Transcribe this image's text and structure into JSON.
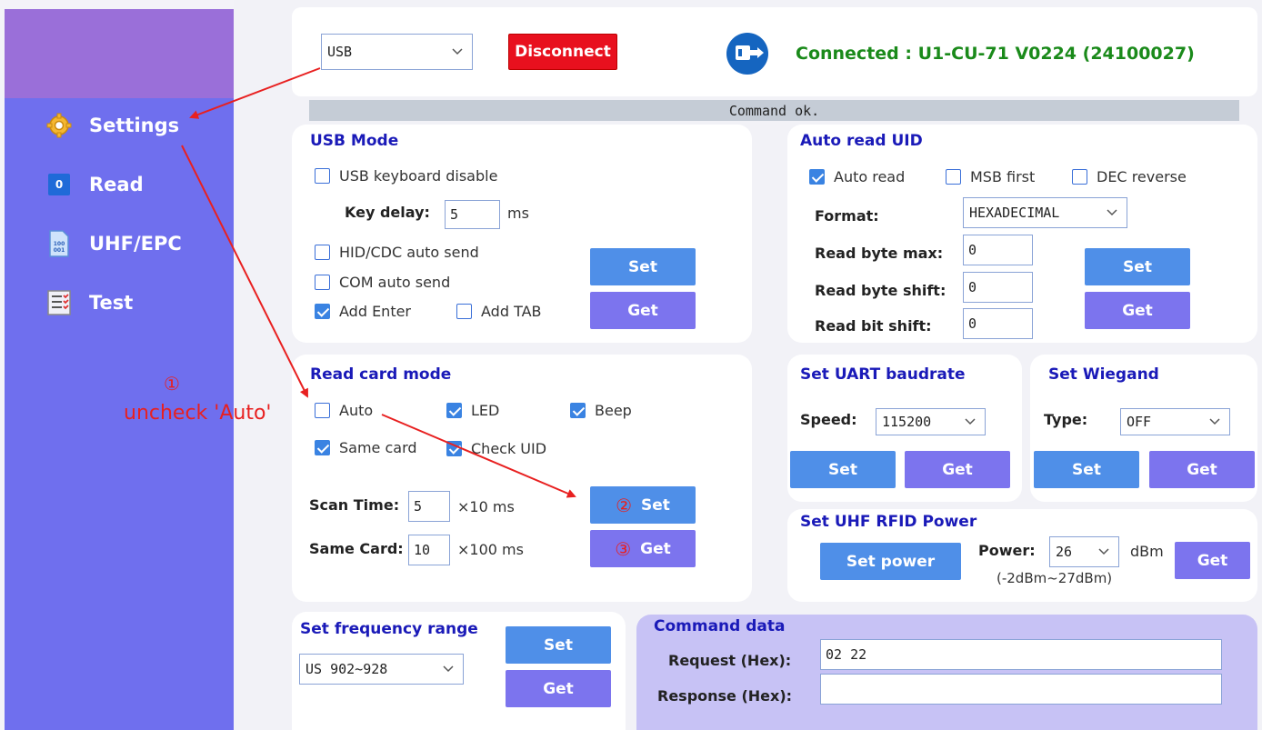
{
  "sidebar": {
    "items": [
      {
        "label": "Settings",
        "icon": "gear-icon"
      },
      {
        "label": "Read",
        "icon": "read-icon",
        "badge": "0"
      },
      {
        "label": "UHF/EPC",
        "icon": "document-icon"
      },
      {
        "label": "Test",
        "icon": "checklist-icon"
      }
    ]
  },
  "header": {
    "port_select": "USB",
    "disconnect_label": "Disconnect",
    "connection_status": "Connected : U1-CU-71 V0224 (24100027)",
    "status_bar": "Command ok."
  },
  "usb_mode": {
    "title": "USB Mode",
    "keyboard_disable": "USB keyboard disable",
    "key_delay_label": "Key delay:",
    "key_delay_value": "5",
    "key_delay_unit": "ms",
    "hid_auto_send": "HID/CDC auto send",
    "com_auto_send": "COM auto send",
    "add_enter": "Add Enter",
    "add_tab": "Add TAB",
    "set_label": "Set",
    "get_label": "Get"
  },
  "auto_read": {
    "title": "Auto read UID",
    "auto_read": "Auto read",
    "msb_first": "MSB first",
    "dec_reverse": "DEC reverse",
    "format_label": "Format:",
    "format_value": "HEXADECIMAL",
    "byte_max_label": "Read byte max:",
    "byte_max_value": "0",
    "byte_shift_label": "Read byte shift:",
    "byte_shift_value": "0",
    "bit_shift_label": "Read bit shift:",
    "bit_shift_value": "0",
    "set_label": "Set",
    "get_label": "Get"
  },
  "read_card": {
    "title": "Read card mode",
    "auto": "Auto",
    "led": "LED",
    "beep": "Beep",
    "same_card": "Same card",
    "check_uid": "Check UID",
    "scan_time_label": "Scan Time:",
    "scan_time_value": "5",
    "scan_time_unit": "×10 ms",
    "same_card_label": "Same Card:",
    "same_card_value": "10",
    "same_card_unit": "×100 ms",
    "set_label": "Set",
    "get_label": "Get"
  },
  "uart": {
    "title": "Set UART baudrate",
    "speed_label": "Speed:",
    "speed_value": "115200",
    "set_label": "Set",
    "get_label": "Get"
  },
  "wiegand": {
    "title": "Set Wiegand",
    "type_label": "Type:",
    "type_value": "OFF",
    "set_label": "Set",
    "get_label": "Get"
  },
  "uhf_power": {
    "title": "Set UHF RFID Power",
    "set_power_label": "Set power",
    "power_label": "Power:",
    "power_value": "26",
    "unit": "dBm",
    "range": "(-2dBm~27dBm)",
    "get_label": "Get"
  },
  "frequency": {
    "title": "Set frequency range",
    "range_value": "US 902~928",
    "set_label": "Set",
    "get_label": "Get"
  },
  "command": {
    "title": "Command data",
    "request_label": "Request (Hex):",
    "request_value": "02 22",
    "response_label": "Response (Hex):",
    "response_value": ""
  },
  "annotations": {
    "step1_mark": "①",
    "step1_text": "uncheck 'Auto'",
    "step2_mark": "②",
    "step3_mark": "③"
  },
  "colors": {
    "sidebar": "#6f6fee",
    "sidebar_top": "#9a6fd9",
    "title_blue": "#1a1ab8",
    "btn_set": "#4f8fe8",
    "btn_get": "#7c74ee",
    "disconnect": "#e8101e",
    "connected_green": "#1a8a1a",
    "annotation_red": "#e82020"
  }
}
